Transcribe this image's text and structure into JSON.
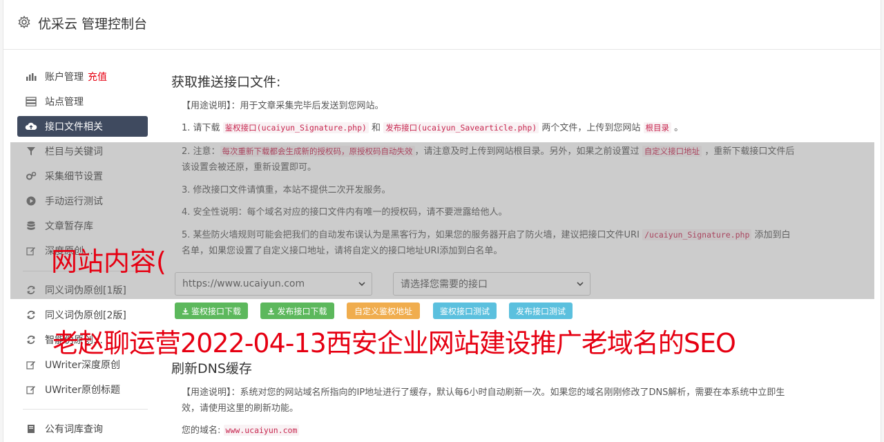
{
  "header": {
    "title": "优采云 管理控制台"
  },
  "sidebar": {
    "items": [
      {
        "label": "账户管理",
        "extra": "充值",
        "icon": "bar-chart-icon"
      },
      {
        "label": "站点管理",
        "icon": "server-icon"
      },
      {
        "label": "接口文件相关",
        "icon": "cloud-upload-icon",
        "active": true
      },
      {
        "label": "栏目与关键词",
        "icon": "filter-icon"
      },
      {
        "label": "采集细节设置",
        "icon": "gears-icon"
      },
      {
        "label": "手动运行测试",
        "icon": "play-circle-icon"
      },
      {
        "label": "文章暂存库",
        "icon": "database-icon"
      },
      {
        "label": "深度原创…",
        "icon": "edit-icon"
      },
      {
        "label": "同义词伪原创[1版]",
        "icon": "refresh-icon"
      },
      {
        "label": "同义词伪原创[2版]",
        "icon": "refresh-icon"
      },
      {
        "label": "智能伪原创…",
        "icon": "refresh-icon"
      },
      {
        "label": "UWriter深度原创",
        "icon": "edit-icon"
      },
      {
        "label": "UWriter原创标题",
        "icon": "edit-icon"
      },
      {
        "label": "公有词库查询",
        "icon": "book-icon"
      }
    ]
  },
  "section1": {
    "title": "获取推送接口文件:",
    "usage": "【用途说明】：用于文章采集完毕后发送到您网站。",
    "item1": {
      "a": "1. 请下载 ",
      "code1": "鉴权接口(ucaiyun_Signature.php)",
      "b": " 和 ",
      "code2": "发布接口(ucaiyun_Savearticle.php)",
      "c": " 两个文件，上传到您网站 ",
      "code3": "根目录",
      "d": " 。"
    },
    "item2": {
      "a": "2. 注意：",
      "code1": "每次重新下载都会生成新的授权码，原授权码自动失效",
      "b": "，请注意及时上传到网站根目录。另外，如果之前设置过 ",
      "code2": "自定义接口地址",
      "c": " ，重新下载接口文件后该设置会被还原，重新设置即可。"
    },
    "item3": "3. 修改接口文件请慎重，本站不提供二次开发服务。",
    "item4": "4. 安全性说明：每个域名对应的接口文件内有唯一的授权码，请不要泄露给他人。",
    "item5": {
      "a": "5. 某些防火墙规则可能会把我们的自动发布误认为是黑客行为，如果您的服务器开启了防火墙，建议把接口文件URI ",
      "code1": "/ucaiyun_Signature.php",
      "b": " 添加到白名单，如果您设置了自定义接口地址，请将自定义的接口地址URI添加到白名单。"
    },
    "site_select": "https://www.ucaiyun.com",
    "api_select": "请选择您需要的接口",
    "buttons": {
      "download_auth": "鉴权接口下载",
      "download_publish": "发布接口下载",
      "custom_auth": "自定义鉴权地址",
      "test_auth": "鉴权接口测试",
      "test_publish": "发布接口测试"
    }
  },
  "section2": {
    "title": "刷新DNS缓存",
    "usage": "【用途说明】：系统对您的网站域名所指向的IP地址进行了缓存，默认每6小时自动刷新一次。如果您的域名刚刚修改了DNS解析，需要在本系统中立即生效，请使用这里的刷新功能。",
    "domain_label": "您的域名:",
    "domain_value": "www.ucaiyun.com"
  },
  "watermark": {
    "line1": "网站内容(",
    "line2": "老赵聊运营2022-04-13西安企业网站建设推广老域名的SEO"
  },
  "colors": {
    "active_nav": "#3f4a5f",
    "green": "#5cb85c",
    "orange": "#f0ad4e",
    "blue": "#5bc0de",
    "red": "#e60012",
    "code": "#c7254e"
  }
}
